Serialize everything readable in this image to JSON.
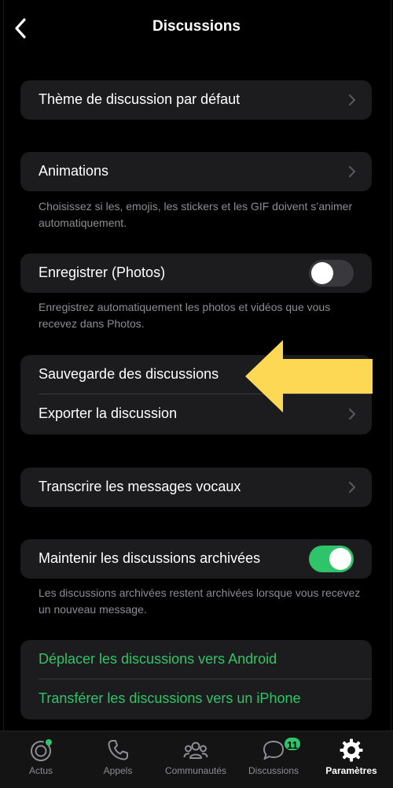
{
  "header": {
    "title": "Discussions"
  },
  "groups": {
    "theme": {
      "label": "Thème de discussion par défaut"
    },
    "animations": {
      "label": "Animations",
      "footnote": "Choisissez si les, emojis, les stickers et les GIF doivent s’animer automatiquement."
    },
    "save_photos": {
      "label": "Enregistrer (Photos)",
      "toggle_on": false,
      "footnote": "Enregistrez automatiquement les photos et vidéos que vous recevez dans Photos."
    },
    "backup": {
      "backup_label": "Sauvegarde des discussions",
      "export_label": "Exporter la discussion"
    },
    "transcribe": {
      "label": "Transcrire les messages vocaux"
    },
    "keep_archived": {
      "label": "Maintenir les discussions archivées",
      "toggle_on": true,
      "footnote": "Les discussions archivées restent archivées lorsque vous recevez un nouveau message."
    },
    "transfer": {
      "android_label": "Déplacer les discussions vers Android",
      "iphone_label": "Transférer les discussions vers un iPhone"
    }
  },
  "tabbar": {
    "items": [
      {
        "label": "Actus",
        "icon": "updates-icon"
      },
      {
        "label": "Appels",
        "icon": "phone-icon"
      },
      {
        "label": "Communautés",
        "icon": "communities-icon"
      },
      {
        "label": "Discussions",
        "icon": "chats-icon",
        "badge": "11"
      },
      {
        "label": "Paramètres",
        "icon": "settings-gear-icon",
        "active": true
      }
    ]
  },
  "colors": {
    "accent": "#2fc46a",
    "arrow": "#fcd855",
    "cell": "#1c1c1e",
    "secondary_text": "#8d8d93"
  }
}
